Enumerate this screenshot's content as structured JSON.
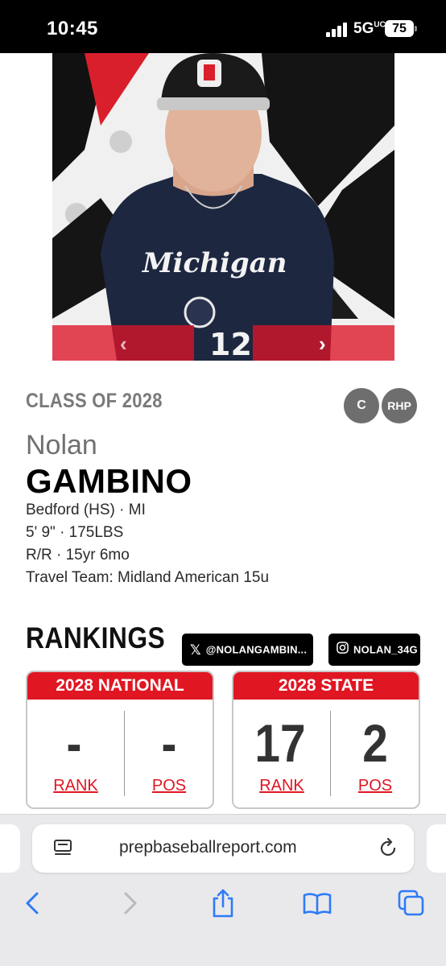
{
  "status_bar": {
    "time": "10:45",
    "network": "5G",
    "network_sup": "UC",
    "battery": "75"
  },
  "colors": {
    "accent_red": "#e01622",
    "badge_gray": "#6e6e6e",
    "text_gray": "#707070"
  },
  "photo": {
    "prev_icon": "chevron-left-icon",
    "next_icon": "chevron-right-icon",
    "prev_glyph": "‹",
    "next_glyph": "›"
  },
  "player": {
    "class_label": "CLASS OF 2028",
    "positions": [
      "C",
      "RHP"
    ],
    "first_name": "Nolan",
    "last_name": "GAMBINO",
    "school": "Bedford (HS) · MI",
    "size": "5' 9\" · 175LBS",
    "bats_age": "R/R · 15yr 6mo",
    "travel_team": "Travel Team: Midland American 15u"
  },
  "rankings": {
    "title": "RANKINGS",
    "social": {
      "x_handle": "@NOLANGAMBIN...",
      "ig_handle": "NOLAN_34G"
    },
    "national": {
      "title": "2028 NATIONAL",
      "rank": "-",
      "pos": "-",
      "rank_label": "RANK",
      "pos_label": "POS"
    },
    "state": {
      "title": "2028 STATE",
      "rank": "17",
      "pos": "2",
      "rank_label": "RANK",
      "pos_label": "POS"
    }
  },
  "browser": {
    "url": "prepbaseballreport.com"
  }
}
